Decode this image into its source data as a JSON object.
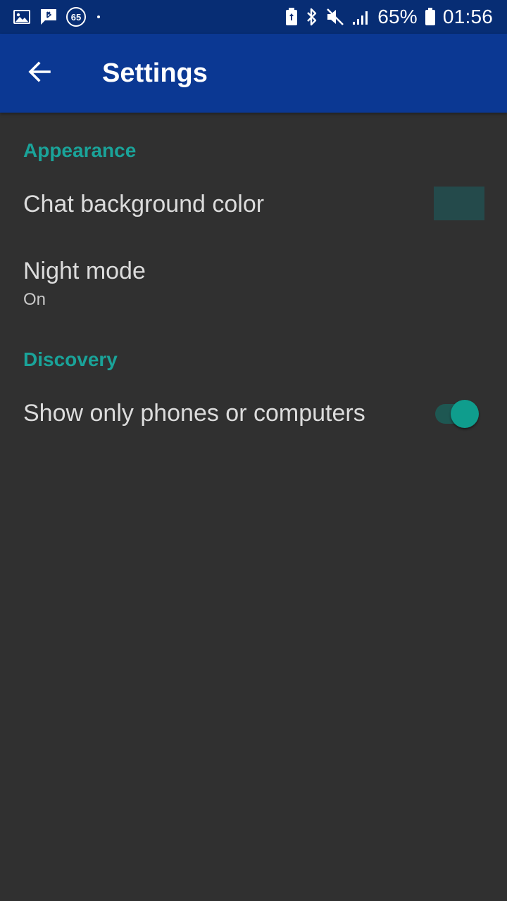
{
  "status_bar": {
    "notification_badge": "65",
    "battery_percent": "65%",
    "time": "01:56",
    "icons_left": [
      "image-icon",
      "chat-notification-icon",
      "badge-65-icon",
      "dot-icon"
    ],
    "icons_right": [
      "battery-saver-icon",
      "bluetooth-icon",
      "mute-icon",
      "signal-icon",
      "battery-icon"
    ]
  },
  "app_bar": {
    "title": "Settings",
    "back_icon": "arrow-left-icon"
  },
  "sections": {
    "appearance": {
      "header": "Appearance",
      "chat_background": {
        "title": "Chat background color",
        "swatch_color": "#244a4b"
      },
      "night_mode": {
        "title": "Night mode",
        "summary": "On"
      }
    },
    "discovery": {
      "header": "Discovery",
      "show_only": {
        "title": "Show only phones or computers",
        "enabled": true
      }
    }
  },
  "colors": {
    "status_bar_bg": "#072d74",
    "app_bar_bg": "#0b3893",
    "background": "#303030",
    "accent": "#1aa399",
    "text_primary": "#dcdcdc"
  }
}
